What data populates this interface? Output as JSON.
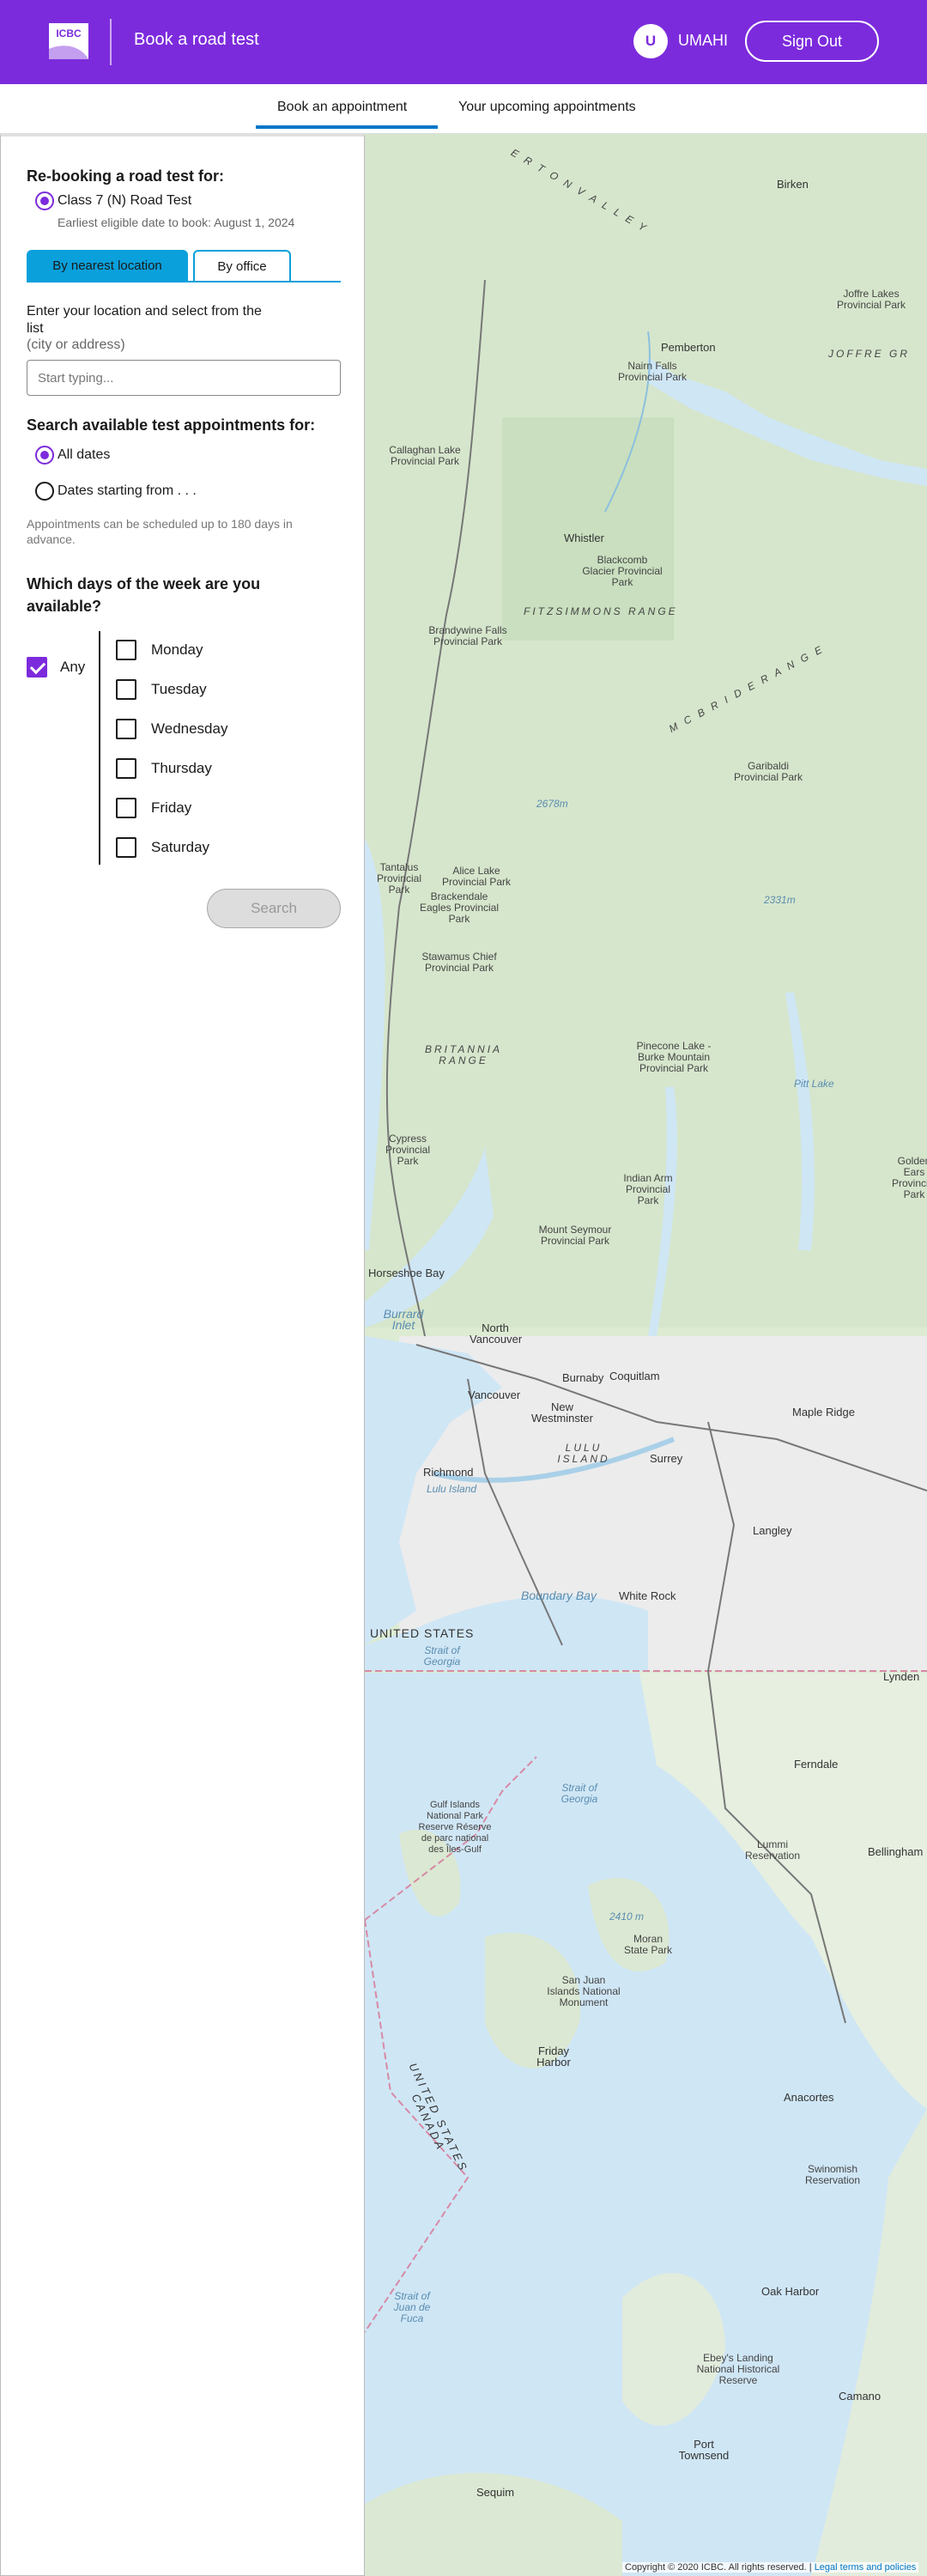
{
  "header": {
    "logo_text": "ICBC",
    "title": "Book a road test",
    "avatar_initial": "U",
    "username": "UMAHI",
    "signout_label": "Sign Out"
  },
  "tabs": [
    {
      "label": "Book an appointment",
      "active": true
    },
    {
      "label": "Your upcoming appointments",
      "active": false
    }
  ],
  "sidebar": {
    "rebooking_heading": "Re-booking a road test for:",
    "test_class": "Class 7 (N) Road Test",
    "eligible_date": "Earliest eligible date to book: August 1, 2024",
    "search_modes": [
      {
        "label": "By nearest location",
        "active": true
      },
      {
        "label": "By office",
        "active": false
      }
    ],
    "location_label": "Enter your location and select from the list",
    "location_sublabel": "(city or address)",
    "location_placeholder": "Start typing...",
    "search_heading": "Search available test appointments for:",
    "date_options": [
      {
        "label": "All dates",
        "selected": true
      },
      {
        "label": "Dates starting from . . .",
        "selected": false
      }
    ],
    "schedule_note": "Appointments can be scheduled up to 180 days in advance.",
    "days_heading": "Which days of the week are you available?",
    "any_label": "Any",
    "any_checked": true,
    "days": [
      {
        "label": "Monday",
        "checked": false
      },
      {
        "label": "Tuesday",
        "checked": false
      },
      {
        "label": "Wednesday",
        "checked": false
      },
      {
        "label": "Thursday",
        "checked": false
      },
      {
        "label": "Friday",
        "checked": false
      },
      {
        "label": "Saturday",
        "checked": false
      }
    ],
    "search_button": "Search"
  },
  "map": {
    "labels": {
      "valley": "E R T O N   V A L L E Y",
      "birken": "Birken",
      "joffre": "Joffre Lakes Provincial Park",
      "joffre_group": "JOFFRE GR",
      "pemberton": "Pemberton",
      "nairn": "Nairn Falls Provincial Park",
      "callaghan": "Callaghan Lake Provincial Park",
      "whistler": "Whistler",
      "blackcomb": "Blackcomb Glacier Provincial Park",
      "fitzsimmons": "FITZSIMMONS RANGE",
      "brandywine": "Brandywine Falls Provincial Park",
      "mcbride": "M C B R I D E   R A N G E",
      "garibaldi": "Garibaldi Provincial Park",
      "tantalus": "Tantalus Provincial Park",
      "alice": "Alice Lake Provincial Park",
      "brackendale": "Brackendale Eagles Provincial Park",
      "stawamus": "Stawamus Chief Provincial Park",
      "britannia": "BRITANNIA RANGE",
      "pinecone": "Pinecone Lake - Burke Mountain Provincial Park",
      "cypress": "Cypress Provincial Park",
      "golden_ears": "Golden Ears Provincial Park",
      "indian_arm": "Indian Arm Provincial Park",
      "seymour": "Mount Seymour Provincial Park",
      "horseshoe": "Horseshoe Bay",
      "burrard": "Burrard Inlet",
      "north_van": "North Vancouver",
      "burnaby": "Burnaby",
      "coquitlam": "Coquitlam",
      "vancouver": "Vancouver",
      "new_west": "New Westminster",
      "maple_ridge": "Maple Ridge",
      "lulu": "LULU ISLAND",
      "richmond": "Richmond",
      "lulu_small": "Lulu Island",
      "surrey": "Surrey",
      "langley": "Langley",
      "boundary_bay": "Boundary Bay",
      "white_rock": "White Rock",
      "united_states": "UNITED STATES",
      "strait_georgia": "Strait of Georgia",
      "lynden": "Lynden",
      "ferndale": "Ferndale",
      "lummi": "Lummi Reservation",
      "bellingham": "Bellingham",
      "gulf_islands": "Gulf Islands National Park Reserve Réserve de parc national des Îles-Gulf",
      "strait_georgia2": "Strait of Georgia",
      "moran": "Moran State Park",
      "san_juan": "San Juan Islands National Monument",
      "friday": "Friday Harbor",
      "us_ca": "UNITED STATES   CANADA",
      "anacortes": "Anacortes",
      "swinomish": "Swinomish Reservation",
      "oak_harbor": "Oak Harbor",
      "strait_juan": "Strait of Juan de Fuca",
      "ebeys": "Ebey's Landing National Historical Reserve",
      "camano": "Camano",
      "port_townsend": "Port Townsend",
      "sequim": "Sequim",
      "pitt_lake": "Pitt Lake",
      "elev_2678": "2678m",
      "elev_2331": "2331m",
      "elev_2410": "2410 m"
    },
    "copyright": "Copyright © 2020 ICBC. All rights reserved. |",
    "legal_link": "Legal terms and policies"
  },
  "colors": {
    "brand": "#7c2bdc",
    "accent": "#0aa0dc",
    "link": "#0077c8",
    "water": "#cfe6f5",
    "land": "#dcebd2"
  }
}
